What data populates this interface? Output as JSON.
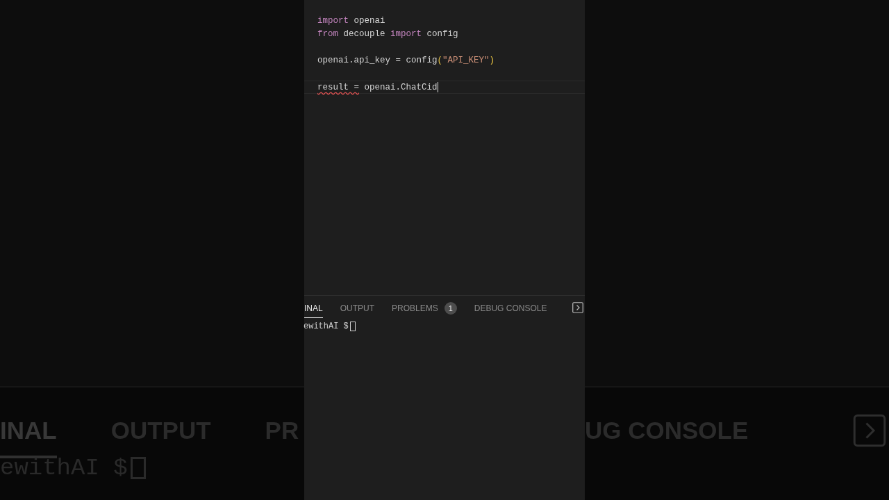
{
  "backdrop_left": {
    "tabs": [
      {
        "label": "INAL",
        "selected": true
      },
      {
        "label": "OUTPUT",
        "selected": false
      },
      {
        "label": "PR",
        "selected": false
      }
    ],
    "prompt": "ewithAI $"
  },
  "editor": {
    "lines": [
      {
        "kind": "code",
        "current": false,
        "tokens": [
          {
            "text": "import",
            "kind": "keyword",
            "error": false
          },
          {
            "text": " openai",
            "kind": "plain",
            "error": false
          }
        ]
      },
      {
        "kind": "code",
        "current": false,
        "tokens": [
          {
            "text": "from",
            "kind": "keyword",
            "error": false
          },
          {
            "text": " decouple ",
            "kind": "plain",
            "error": false
          },
          {
            "text": "import",
            "kind": "keyword",
            "error": false
          },
          {
            "text": " config",
            "kind": "plain",
            "error": false
          }
        ]
      },
      {
        "kind": "blank"
      },
      {
        "kind": "code",
        "current": false,
        "tokens": [
          {
            "text": "openai.api_key = config",
            "kind": "plain",
            "error": false
          },
          {
            "text": "(",
            "kind": "bracket",
            "error": false
          },
          {
            "text": "\"API_KEY\"",
            "kind": "string",
            "error": false
          },
          {
            "text": ")",
            "kind": "bracket",
            "error": false
          }
        ]
      },
      {
        "kind": "blank"
      },
      {
        "kind": "code",
        "current": true,
        "tokens": [
          {
            "text": "result =",
            "kind": "plain",
            "error": true
          },
          {
            "text": " openai.ChatCid",
            "kind": "plain",
            "error": false
          }
        ]
      }
    ]
  },
  "panel": {
    "tabs": [
      {
        "label": "INAL",
        "selected": true
      },
      {
        "label": "OUTPUT",
        "selected": false
      },
      {
        "label": "PROBLEMS",
        "selected": false,
        "badge": "1"
      },
      {
        "label": "DEBUG CONSOLE",
        "selected": false
      }
    ],
    "prompt": "ewithAI $"
  },
  "backdrop_right": {
    "tabs": [
      {
        "label": "UG CONSOLE",
        "selected": false
      }
    ]
  }
}
